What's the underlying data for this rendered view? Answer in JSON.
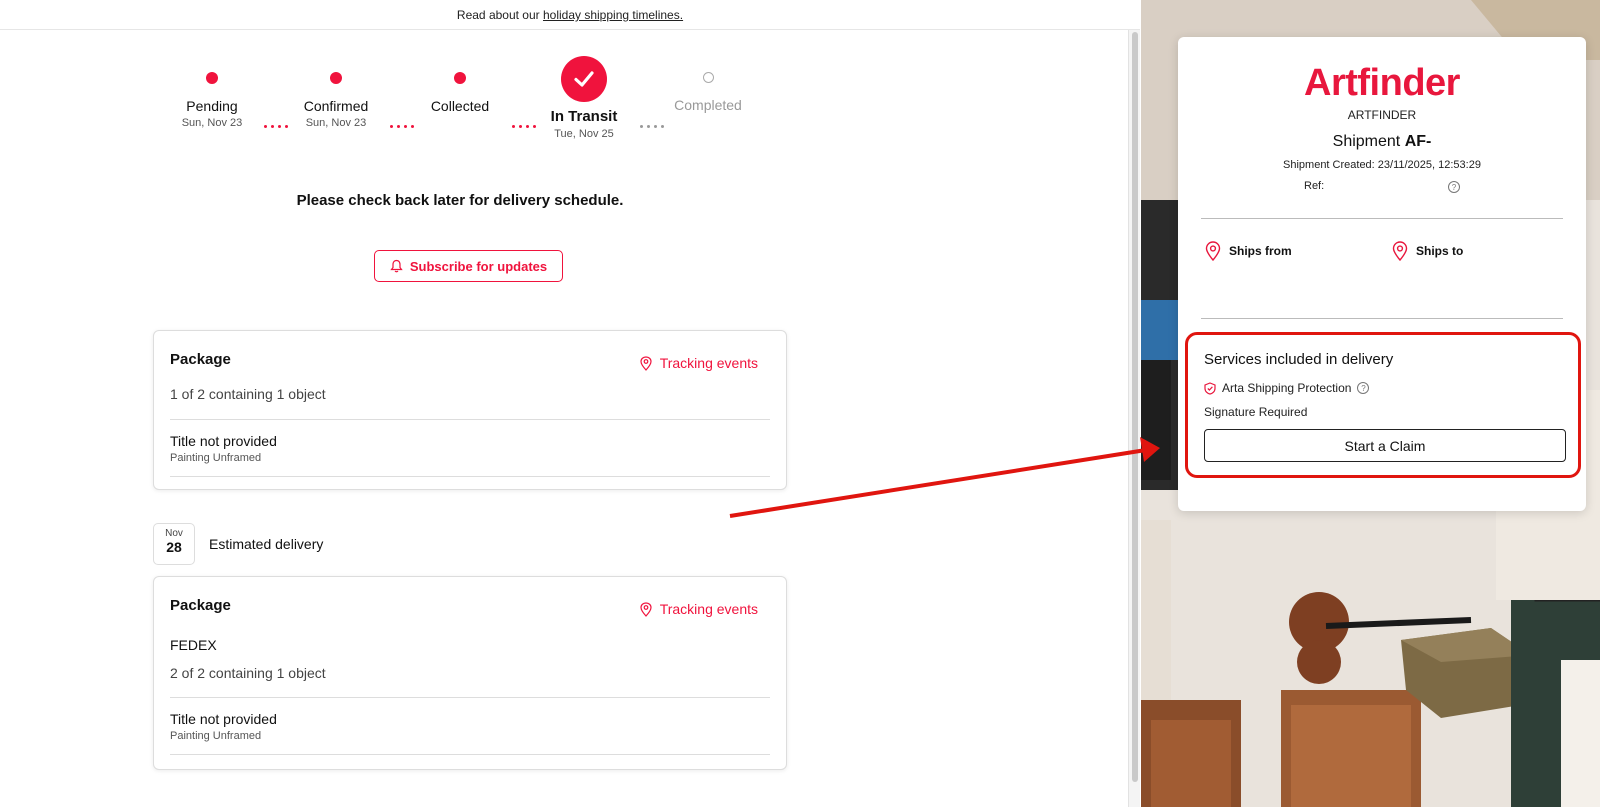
{
  "banner": {
    "text": "Read about our ",
    "link": "holiday shipping timelines."
  },
  "stepper": {
    "steps": [
      {
        "label": "Pending",
        "date": "Sun, Nov 23",
        "state": "done"
      },
      {
        "label": "Confirmed",
        "date": "Sun, Nov 23",
        "state": "done"
      },
      {
        "label": "Collected",
        "date": "",
        "state": "done"
      },
      {
        "label": "In Transit",
        "date": "Tue, Nov 25",
        "state": "current"
      },
      {
        "label": "Completed",
        "date": "",
        "state": "pending"
      }
    ]
  },
  "status_message": "Please check back later for delivery schedule.",
  "subscribe_label": "Subscribe for updates",
  "packages": [
    {
      "title": "Package",
      "tracking_label": "Tracking events",
      "carrier": "",
      "count": "1 of 2 containing 1 object",
      "item_title": "Title not provided",
      "item_type": "Painting Unframed"
    },
    {
      "title": "Package",
      "tracking_label": "Tracking events",
      "carrier": "FEDEX",
      "count": "2 of 2 containing 1 object",
      "item_title": "Title not provided",
      "item_type": "Painting Unframed"
    }
  ],
  "estimated": {
    "month": "Nov",
    "day": "28",
    "label": "Estimated delivery"
  },
  "panel": {
    "brand": "Artfinder",
    "brand_sub": "ARTFINDER",
    "shipment_prefix": "Shipment ",
    "shipment_id": "AF-",
    "created": "Shipment Created: 23/11/2025, 12:53:29",
    "ref_label": "Ref:",
    "ships_from": "Ships from",
    "ships_to": "Ships to",
    "services_title": "Services included in delivery",
    "protection_label": "Arta Shipping Protection",
    "signature_label": "Signature Required",
    "claim_label": "Start a Claim"
  },
  "colors": {
    "accent": "#f0133d",
    "annotation": "#e0150f"
  }
}
